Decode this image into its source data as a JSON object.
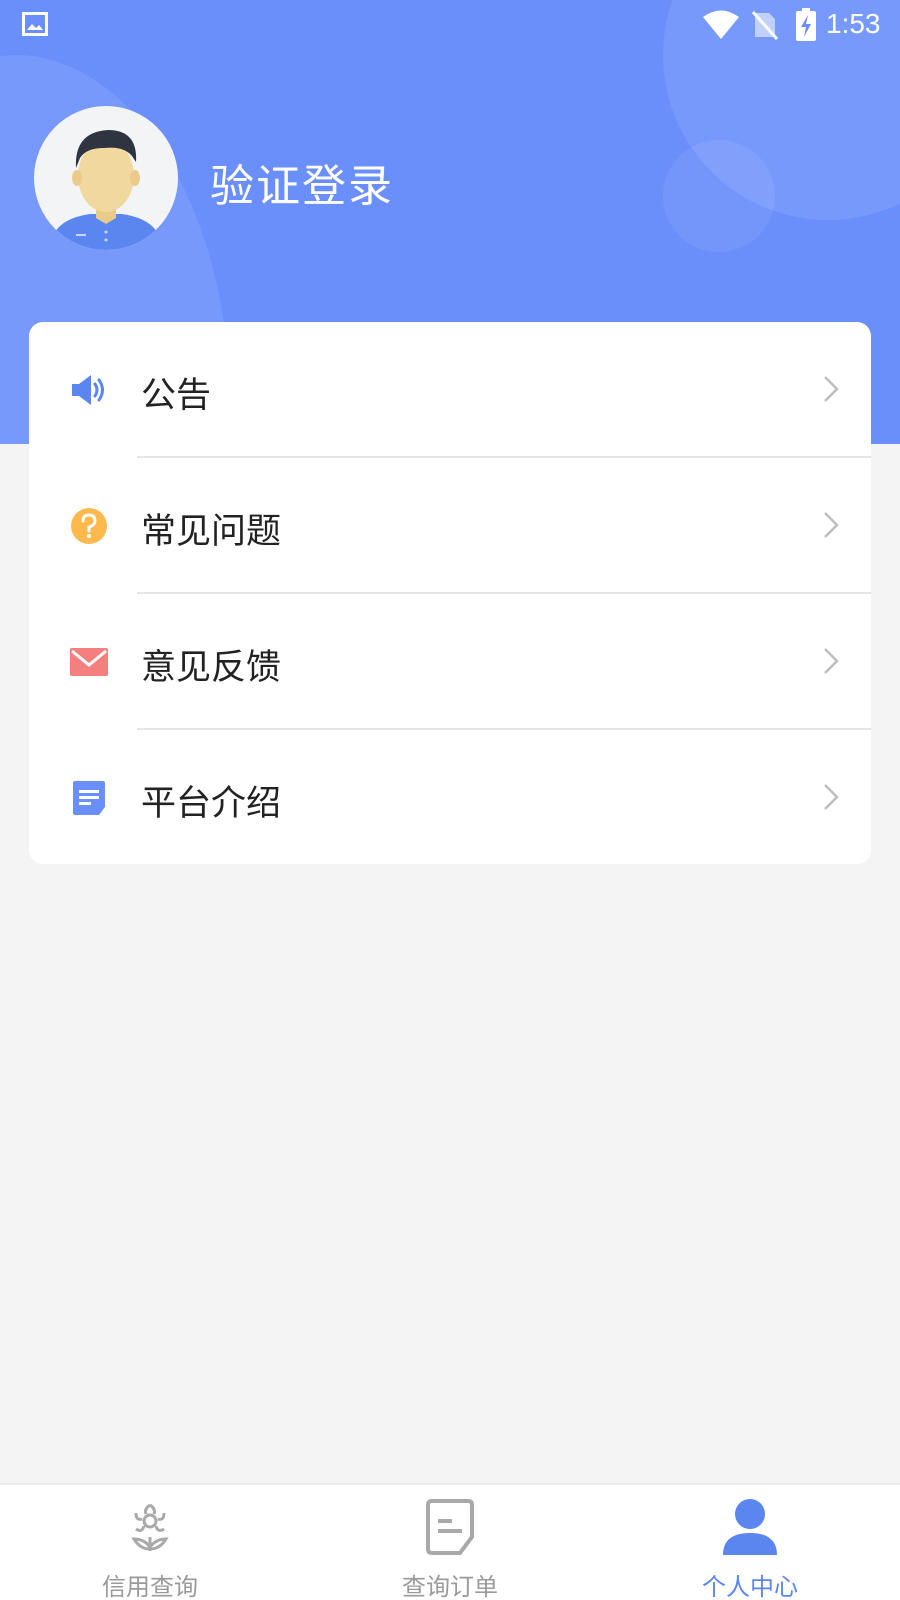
{
  "status_bar": {
    "time": "1:53"
  },
  "header": {
    "login_label": "验证登录"
  },
  "menu": {
    "items": [
      {
        "label": "公告",
        "icon": "speaker-icon"
      },
      {
        "label": "常见问题",
        "icon": "question-icon"
      },
      {
        "label": "意见反馈",
        "icon": "mail-icon"
      },
      {
        "label": "平台介绍",
        "icon": "document-icon"
      }
    ]
  },
  "tabbar": {
    "tabs": [
      {
        "label": "信用查询",
        "icon": "flower-icon",
        "active": false
      },
      {
        "label": "查询订单",
        "icon": "order-icon",
        "active": false
      },
      {
        "label": "个人中心",
        "icon": "person-icon",
        "active": true
      }
    ]
  },
  "colors": {
    "header_blue": "#6a8ffb",
    "accent": "#5b86f0",
    "question_orange": "#fdb94b",
    "mail_red": "#f47f7f"
  }
}
